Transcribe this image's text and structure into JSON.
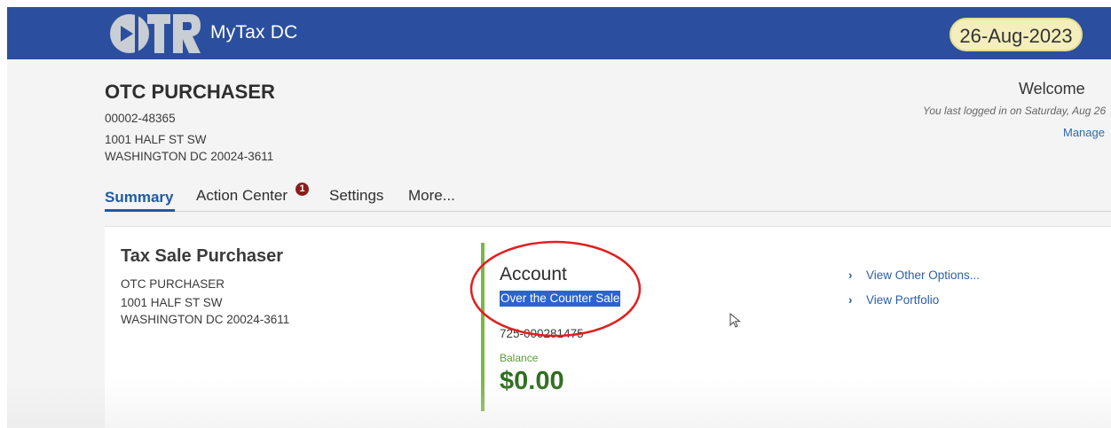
{
  "header": {
    "app_title": "MyTax DC",
    "date": "26-Aug-2023",
    "logo_text": "OTR",
    "brand_color": "#2b4f9e"
  },
  "account_header": {
    "name": "OTC PURCHASER",
    "id": "00002-48365",
    "address_line1": "1001 HALF ST SW",
    "address_line2": "WASHINGTON DC 20024-3611",
    "welcome": "Welcome",
    "last_login": "You last logged in on Saturday, Aug 26",
    "manage": "Manage"
  },
  "tabs": [
    {
      "label": "Summary",
      "active": true
    },
    {
      "label": "Action Center",
      "active": false,
      "badge": "1"
    },
    {
      "label": "Settings",
      "active": false
    },
    {
      "label": "More...",
      "active": false
    }
  ],
  "purchaser": {
    "title": "Tax Sale Purchaser",
    "name": "OTC PURCHASER",
    "address_line1": "1001 HALF ST SW",
    "address_line2": "WASHINGTON DC 20024-3611"
  },
  "account_card": {
    "title": "Account",
    "type": "Over the Counter Sale",
    "number": "725-000281475",
    "balance_label": "Balance",
    "balance_value": "$0.00",
    "accent_color": "#7ab648"
  },
  "options": [
    {
      "label": "View Other Options..."
    },
    {
      "label": "View Portfolio"
    }
  ]
}
